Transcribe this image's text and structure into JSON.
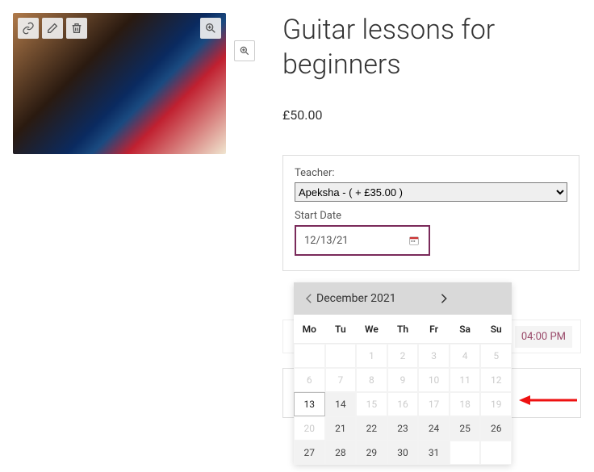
{
  "product": {
    "title": "Guitar lessons for beginners",
    "price": "£50.00"
  },
  "form": {
    "teacher_label": "Teacher:",
    "teacher_value": "Apeksha - ( + £35.00 )",
    "start_date_label": "Start Date",
    "start_date_value": "12/13/21"
  },
  "time_slot": "04:00 PM",
  "calendar": {
    "title": "December 2021",
    "dow": [
      "Mo",
      "Tu",
      "We",
      "Th",
      "Fr",
      "Sa",
      "Su"
    ],
    "rows": [
      [
        {
          "n": "",
          "s": ""
        },
        {
          "n": "",
          "s": ""
        },
        {
          "n": "1",
          "s": "dis"
        },
        {
          "n": "2",
          "s": "dis"
        },
        {
          "n": "3",
          "s": "dis"
        },
        {
          "n": "4",
          "s": "dis"
        },
        {
          "n": "5",
          "s": "dis"
        }
      ],
      [
        {
          "n": "6",
          "s": "dis"
        },
        {
          "n": "7",
          "s": "dis"
        },
        {
          "n": "8",
          "s": "dis"
        },
        {
          "n": "9",
          "s": "dis"
        },
        {
          "n": "10",
          "s": "dis"
        },
        {
          "n": "11",
          "s": "dis"
        },
        {
          "n": "12",
          "s": "dis"
        }
      ],
      [
        {
          "n": "13",
          "s": "today"
        },
        {
          "n": "14",
          "s": "en"
        },
        {
          "n": "15",
          "s": "dis"
        },
        {
          "n": "16",
          "s": "dis"
        },
        {
          "n": "17",
          "s": "dis"
        },
        {
          "n": "18",
          "s": "dis"
        },
        {
          "n": "19",
          "s": "dis"
        }
      ],
      [
        {
          "n": "20",
          "s": "dis"
        },
        {
          "n": "21",
          "s": "en"
        },
        {
          "n": "22",
          "s": "en"
        },
        {
          "n": "23",
          "s": "en"
        },
        {
          "n": "24",
          "s": "en"
        },
        {
          "n": "25",
          "s": "en"
        },
        {
          "n": "26",
          "s": "en"
        }
      ],
      [
        {
          "n": "27",
          "s": "en"
        },
        {
          "n": "28",
          "s": "en"
        },
        {
          "n": "29",
          "s": "en"
        },
        {
          "n": "30",
          "s": "en"
        },
        {
          "n": "31",
          "s": "en"
        },
        {
          "n": "",
          "s": ""
        },
        {
          "n": "",
          "s": ""
        }
      ]
    ]
  }
}
